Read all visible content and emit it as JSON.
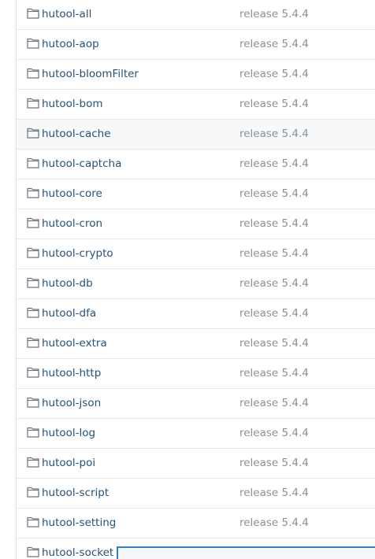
{
  "colors": {
    "link": "#24527a",
    "muted": "#8a9099",
    "row_border": "#e6e9ec",
    "hover_row": "#f6f8fa",
    "tooltip_border": "#2f7fd1"
  },
  "files": [
    {
      "name": "hutool-all",
      "message": "release 5.4.4",
      "icon": "folder-icon"
    },
    {
      "name": "hutool-aop",
      "message": "release 5.4.4",
      "icon": "folder-icon"
    },
    {
      "name": "hutool-bloomFilter",
      "message": "release 5.4.4",
      "icon": "folder-icon"
    },
    {
      "name": "hutool-bom",
      "message": "release 5.4.4",
      "icon": "folder-icon"
    },
    {
      "name": "hutool-cache",
      "message": "release 5.4.4",
      "icon": "folder-icon",
      "hovered": true
    },
    {
      "name": "hutool-captcha",
      "message": "release 5.4.4",
      "icon": "folder-icon"
    },
    {
      "name": "hutool-core",
      "message": "release 5.4.4",
      "icon": "folder-icon"
    },
    {
      "name": "hutool-cron",
      "message": "release 5.4.4",
      "icon": "folder-icon"
    },
    {
      "name": "hutool-crypto",
      "message": "release 5.4.4",
      "icon": "folder-icon"
    },
    {
      "name": "hutool-db",
      "message": "release 5.4.4",
      "icon": "folder-icon"
    },
    {
      "name": "hutool-dfa",
      "message": "release 5.4.4",
      "icon": "folder-icon"
    },
    {
      "name": "hutool-extra",
      "message": "release 5.4.4",
      "icon": "folder-icon"
    },
    {
      "name": "hutool-http",
      "message": "release 5.4.4",
      "icon": "folder-icon"
    },
    {
      "name": "hutool-json",
      "message": "release 5.4.4",
      "icon": "folder-icon"
    },
    {
      "name": "hutool-log",
      "message": "release 5.4.4",
      "icon": "folder-icon"
    },
    {
      "name": "hutool-poi",
      "message": "release 5.4.4",
      "icon": "folder-icon"
    },
    {
      "name": "hutool-script",
      "message": "release 5.4.4",
      "icon": "folder-icon"
    },
    {
      "name": "hutool-setting",
      "message": "release 5.4.4",
      "icon": "folder-icon"
    },
    {
      "name": "hutool-socket",
      "message": "",
      "icon": "folder-icon"
    }
  ]
}
